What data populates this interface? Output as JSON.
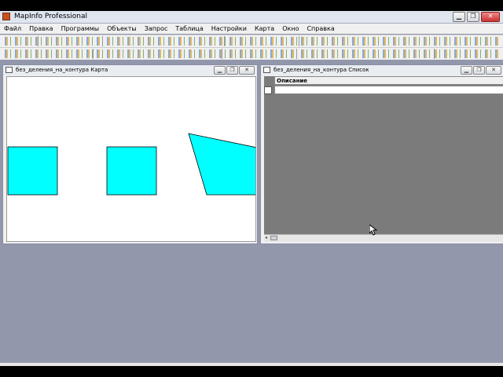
{
  "app": {
    "title": "MapInfo Professional",
    "accent": "#c8501e"
  },
  "menus": [
    "Файл",
    "Правка",
    "Программы",
    "Объекты",
    "Запрос",
    "Таблица",
    "Настройки",
    "Карта",
    "Окно",
    "Справка"
  ],
  "map_window": {
    "title": "без_деления_на_контура Карта",
    "fill_color": "#00ffff",
    "outline_color": "#000000"
  },
  "browser_window": {
    "title": "без_деления_на_контура Список",
    "column_header": "Описание",
    "background_color": "#7b7b7b"
  }
}
